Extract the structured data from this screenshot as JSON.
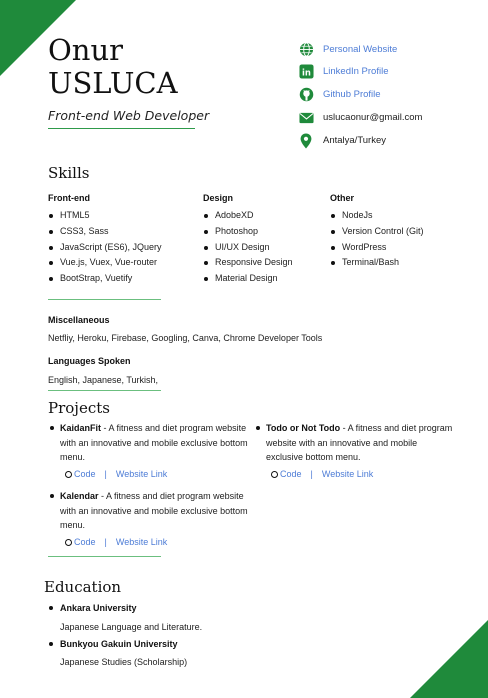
{
  "header": {
    "first_name": "Onur",
    "last_name": "USLUCA",
    "job_title": "Front-end Web Developer"
  },
  "contact": {
    "website": "Personal Website",
    "linkedin": "LinkedIn Profile",
    "github": "Github Profile",
    "email": "uslucaonur@gmail.com",
    "location": "Antalya/Turkey"
  },
  "skills": {
    "heading": "Skills",
    "frontend": {
      "title": "Front-end",
      "items": [
        "HTML5",
        "CSS3, Sass",
        "JavaScript (ES6), JQuery",
        "Vue.js, Vuex, Vue-router",
        "BootStrap, Vuetify"
      ]
    },
    "design": {
      "title": "Design",
      "items": [
        "AdobeXD",
        "Photoshop",
        "UI/UX Design",
        "Responsive Design",
        "Material Design"
      ]
    },
    "other": {
      "title": "Other",
      "items": [
        "NodeJs",
        "Version Control (Git)",
        "WordPress",
        "Terminal/Bash"
      ]
    },
    "misc_title": "Miscellaneous",
    "misc_text": "Netfliy, Heroku, Firebase, Googling, Canva, Chrome Developer Tools",
    "languages_title": "Languages Spoken",
    "languages_text": "English, Japanese, Turkish,"
  },
  "projects": {
    "heading": "Projects",
    "items": [
      {
        "name": "KaidanFit",
        "desc": " - A fitness and diet program website with an innovative and mobile exclusive bottom menu.",
        "code": "Code",
        "sep": "|",
        "link": "Website Link"
      },
      {
        "name": "Todo or Not Todo",
        "desc": " - A fitness and diet program website with an innovative and mobile exclusive bottom menu.",
        "code": "Code",
        "sep": "|",
        "link": "Website Link"
      },
      {
        "name": "Kalendar",
        "desc": " - A fitness and diet program website with an innovative and mobile exclusive bottom menu.",
        "code": "Code",
        "sep": "|",
        "link": "Website Link"
      }
    ]
  },
  "education": {
    "heading": "Education",
    "items": [
      {
        "school": "Ankara University",
        "dept": "Japanese Language and Literature."
      },
      {
        "school": "Bunkyou Gakuin University",
        "dept": "Japanese Studies (Scholarship)"
      }
    ]
  },
  "colors": {
    "accent_green": "#1f8a3b",
    "link_blue": "#4d7cd6"
  }
}
